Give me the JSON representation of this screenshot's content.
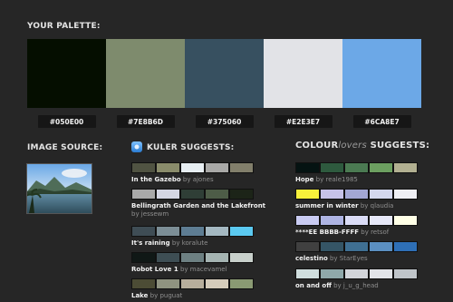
{
  "palette": {
    "title": "YOUR PALETTE:",
    "colors": [
      "#050E00",
      "#7E8B6D",
      "#375060",
      "#E2E3E7",
      "#6CA8E7"
    ],
    "labels": [
      "#050E00",
      "#7E8B6D",
      "#375060",
      "#E2E3E7",
      "#6CA8E7"
    ]
  },
  "image_source": {
    "title": "IMAGE SOURCE:"
  },
  "kuler": {
    "title": "KULER SUGGESTS:",
    "items": [
      {
        "name": "In the Gazebo",
        "by": "by ajones",
        "colors": [
          "#505342",
          "#8A8C6B",
          "#E7EEF2",
          "#A9A9A7",
          "#827F6B"
        ]
      },
      {
        "name": "Bellingrath Garden and the Lakefront",
        "by": "by jessewm",
        "colors": [
          "#A9A9A9",
          "#D4D6E3",
          "#2F3E36",
          "#4D5C47",
          "#1C2418"
        ]
      },
      {
        "name": "It's raining",
        "by": "by koralute",
        "colors": [
          "#3F4D55",
          "#7C8E96",
          "#5E7D93",
          "#A4B8C1",
          "#5BC9F0"
        ]
      },
      {
        "name": "Robot Love 1",
        "by": "by macevamel",
        "colors": [
          "#101816",
          "#3E4E54",
          "#6D8082",
          "#A5B4B2",
          "#C8D0CB"
        ]
      },
      {
        "name": "Lake",
        "by": "by puguat",
        "colors": [
          "#4C4C35",
          "#8F9380",
          "#B7AE9C",
          "#D4CBBA",
          "#8A9A73"
        ]
      }
    ]
  },
  "colourlovers": {
    "title_a": "COLOUR",
    "title_b": "lovers",
    "title_c": " SUGGESTS:",
    "items": [
      {
        "name": "Hope",
        "by": "by reale1985",
        "colors": [
          "#051312",
          "#2E5A3E",
          "#4B7A52",
          "#6C9F60",
          "#B2B091"
        ]
      },
      {
        "name": "summer in winter",
        "by": "by qlaudia",
        "colors": [
          "#F7F03B",
          "#C6C2E8",
          "#A3A7D4",
          "#D4D8EE",
          "#EFEFF4"
        ]
      },
      {
        "name": "****EE BBBB-FFFF",
        "by": "by retsof",
        "colors": [
          "#C9CBF2",
          "#AEB4E3",
          "#DADCF6",
          "#E6E8F8",
          "#FFFFE6"
        ]
      },
      {
        "name": "celestino",
        "by": "by StarEyes",
        "colors": [
          "#404040",
          "#355566",
          "#3F6F92",
          "#5B8FC1",
          "#2E6FB6"
        ]
      },
      {
        "name": "on and off",
        "by": "by j_u_g_head",
        "colors": [
          "#CFDDDD",
          "#8FA8AA",
          "#D2D4D9",
          "#E2E4E8",
          "#BFC4C9"
        ]
      }
    ]
  }
}
